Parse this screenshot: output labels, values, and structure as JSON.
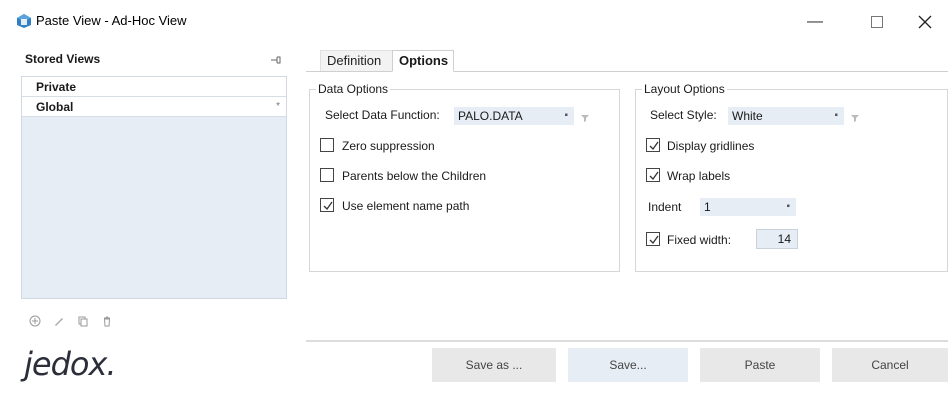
{
  "window": {
    "title": "Paste View - Ad-Hoc View",
    "controls": {
      "minimize": "—",
      "maximize": "☐",
      "close": "✕"
    }
  },
  "stored_views": {
    "title": "Stored Views",
    "items": [
      {
        "label": "Private",
        "marker": ""
      },
      {
        "label": "Global",
        "marker": "*"
      }
    ],
    "toolbar": [
      "add-icon",
      "edit-icon",
      "copy-icon",
      "delete-icon"
    ]
  },
  "tabs": [
    {
      "label": "Definition",
      "active": false
    },
    {
      "label": "Options",
      "active": true
    }
  ],
  "data_options": {
    "title": "Data Options",
    "function_label": "Select Data Function:",
    "function_value": "PALO.DATA",
    "checkboxes": [
      {
        "label": "Zero suppression",
        "checked": false
      },
      {
        "label": "Parents below the Children",
        "checked": false
      },
      {
        "label": "Use element name path",
        "checked": true
      }
    ]
  },
  "layout_options": {
    "title": "Layout Options",
    "style_label": "Select Style:",
    "style_value": "White",
    "display_gridlines": {
      "label": "Display gridlines",
      "checked": true
    },
    "wrap_labels": {
      "label": "Wrap labels",
      "checked": true
    },
    "indent_label": "Indent",
    "indent_value": "1",
    "fixed_width": {
      "label": "Fixed width:",
      "checked": true,
      "value": "14"
    }
  },
  "footer": {
    "logo": "jedox",
    "logo_dot": ".",
    "buttons": {
      "save_as": "Save as ...",
      "save": "Save...",
      "paste": "Paste",
      "cancel": "Cancel"
    }
  },
  "colors": {
    "accent_field": "#e6edf5",
    "button_bg": "#e8e8e8",
    "app_icon": "#2f7fc1"
  }
}
